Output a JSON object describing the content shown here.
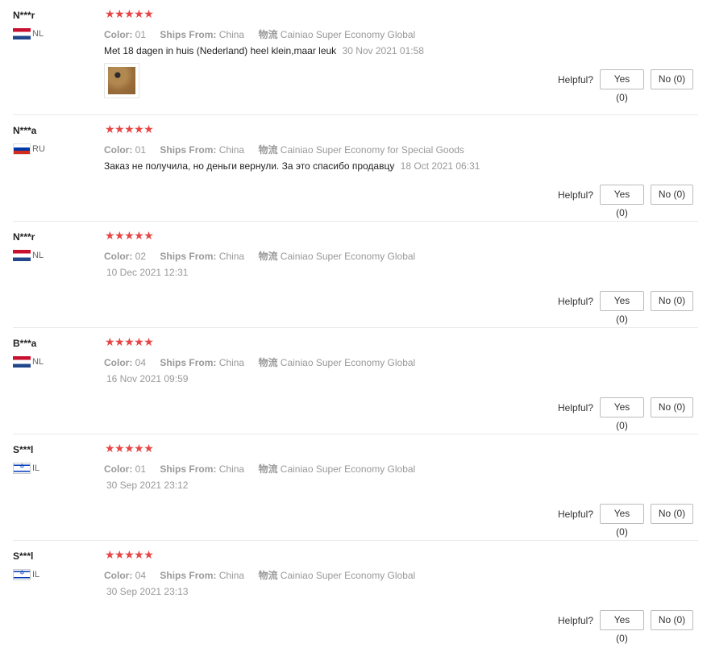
{
  "reviews": [
    {
      "name": "N***r",
      "country": "NL",
      "flag": "nl",
      "stars": "★★★★★",
      "color_label": "Color:",
      "color": "01",
      "ships_label": "Ships From:",
      "ships": "China",
      "logistics_label": "物流",
      "logistics": "Cainiao Super Economy Global",
      "text": "Met 18 dagen in huis (Nederland) heel klein,maar leuk",
      "date": "30 Nov 2021 01:58",
      "has_photo": true,
      "helpful_label": "Helpful?",
      "yes": "Yes (0)",
      "no": "No (0)"
    },
    {
      "name": "N***a",
      "country": "RU",
      "flag": "ru",
      "stars": "★★★★★",
      "color_label": "Color:",
      "color": "01",
      "ships_label": "Ships From:",
      "ships": "China",
      "logistics_label": "物流",
      "logistics": "Cainiao Super Economy for Special Goods",
      "text": "Заказ не получила, но деньги вернули. За это спасибо продавцу",
      "date": "18 Oct 2021 06:31",
      "helpful_label": "Helpful?",
      "yes": "Yes (0)",
      "no": "No (0)"
    },
    {
      "name": "N***r",
      "country": "NL",
      "flag": "nl",
      "stars": "★★★★★",
      "color_label": "Color:",
      "color": "02",
      "ships_label": "Ships From:",
      "ships": "China",
      "logistics_label": "物流",
      "logistics": "Cainiao Super Economy Global",
      "date": "10 Dec 2021 12:31",
      "helpful_label": "Helpful?",
      "yes": "Yes (0)",
      "no": "No (0)"
    },
    {
      "name": "B***a",
      "country": "NL",
      "flag": "nl",
      "stars": "★★★★★",
      "color_label": "Color:",
      "color": "04",
      "ships_label": "Ships From:",
      "ships": "China",
      "logistics_label": "物流",
      "logistics": "Cainiao Super Economy Global",
      "date": "16 Nov 2021 09:59",
      "helpful_label": "Helpful?",
      "yes": "Yes (0)",
      "no": "No (0)"
    },
    {
      "name": "S***l",
      "country": "IL",
      "flag": "il",
      "stars": "★★★★★",
      "color_label": "Color:",
      "color": "01",
      "ships_label": "Ships From:",
      "ships": "China",
      "logistics_label": "物流",
      "logistics": "Cainiao Super Economy Global",
      "date": "30 Sep 2021 23:12",
      "helpful_label": "Helpful?",
      "yes": "Yes (0)",
      "no": "No (0)"
    },
    {
      "name": "S***l",
      "country": "IL",
      "flag": "il",
      "stars": "★★★★★",
      "color_label": "Color:",
      "color": "04",
      "ships_label": "Ships From:",
      "ships": "China",
      "logistics_label": "物流",
      "logistics": "Cainiao Super Economy Global",
      "date": "30 Sep 2021 23:13",
      "helpful_label": "Helpful?",
      "yes": "Yes (0)",
      "no": "No (0)"
    }
  ],
  "colors": {
    "star": "#e64545",
    "muted": "#999999",
    "border": "#e8e8e8"
  }
}
